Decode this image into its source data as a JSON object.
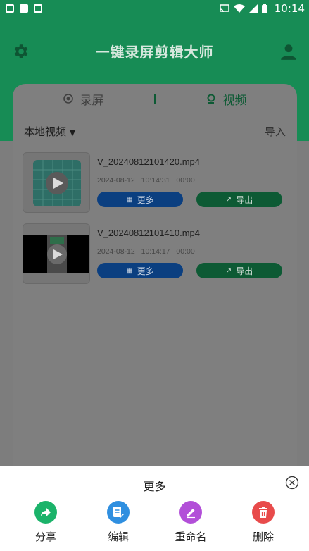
{
  "status_bar": {
    "left_icons": [
      "gallery-icon",
      "square-icon",
      "a-icon"
    ],
    "time": "10:14"
  },
  "header": {
    "title": "一键录屏剪辑大师",
    "colors": {
      "brand": "#178c55"
    }
  },
  "tabs": [
    {
      "label": "录屏",
      "icon": "record-icon"
    },
    {
      "label": "视频",
      "icon": "location-icon"
    }
  ],
  "filter": {
    "label": "本地视频",
    "import_label": "导入"
  },
  "videos": [
    {
      "name": "V_20240812101420.mp4",
      "date": "2024-08-12 10:14:31",
      "duration": "00:00",
      "more_label": "更多",
      "export_label": "导出"
    },
    {
      "name": "V_20240812101410.mp4",
      "date": "2024-08-12 10:14:17",
      "duration": "00:00",
      "more_label": "更多",
      "export_label": "导出"
    }
  ],
  "sheet": {
    "title": "更多",
    "actions": [
      {
        "label": "分享",
        "icon": "share-icon",
        "color": "#1bb36a"
      },
      {
        "label": "编辑",
        "icon": "edit-doc-icon",
        "color": "#2f8fe0"
      },
      {
        "label": "重命名",
        "icon": "pencil-icon",
        "color": "#b24fd8"
      },
      {
        "label": "删除",
        "icon": "trash-icon",
        "color": "#e84b4b"
      }
    ]
  }
}
